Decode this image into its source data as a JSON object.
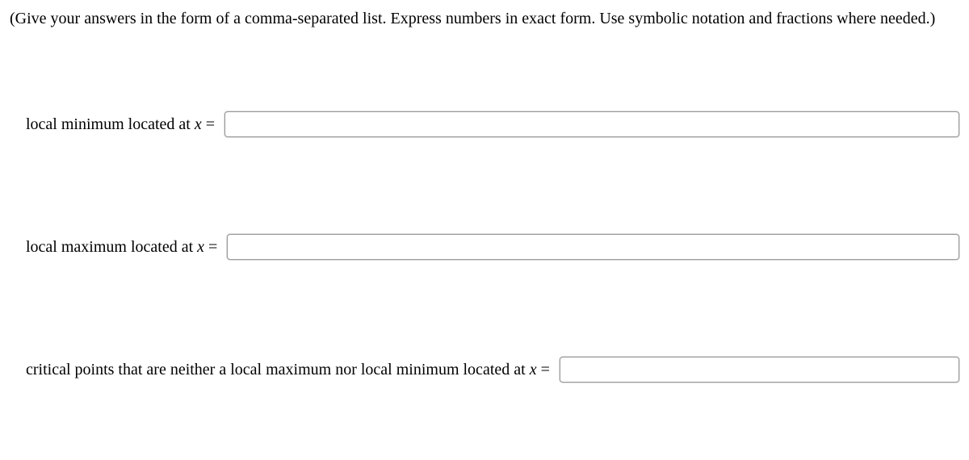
{
  "instructions": "(Give your answers in the form of a comma-separated list. Express numbers in exact form. Use symbolic notation and fractions where needed.)",
  "fields": {
    "localMin": {
      "labelPrefix": "local minimum located at ",
      "var": "x",
      "labelSuffix": " ="
    },
    "localMax": {
      "labelPrefix": "local maximum located at ",
      "var": "x",
      "labelSuffix": " ="
    },
    "neither": {
      "labelPrefix": "critical points that are neither a local maximum nor local minimum located at ",
      "var": "x",
      "labelSuffix": " ="
    }
  }
}
